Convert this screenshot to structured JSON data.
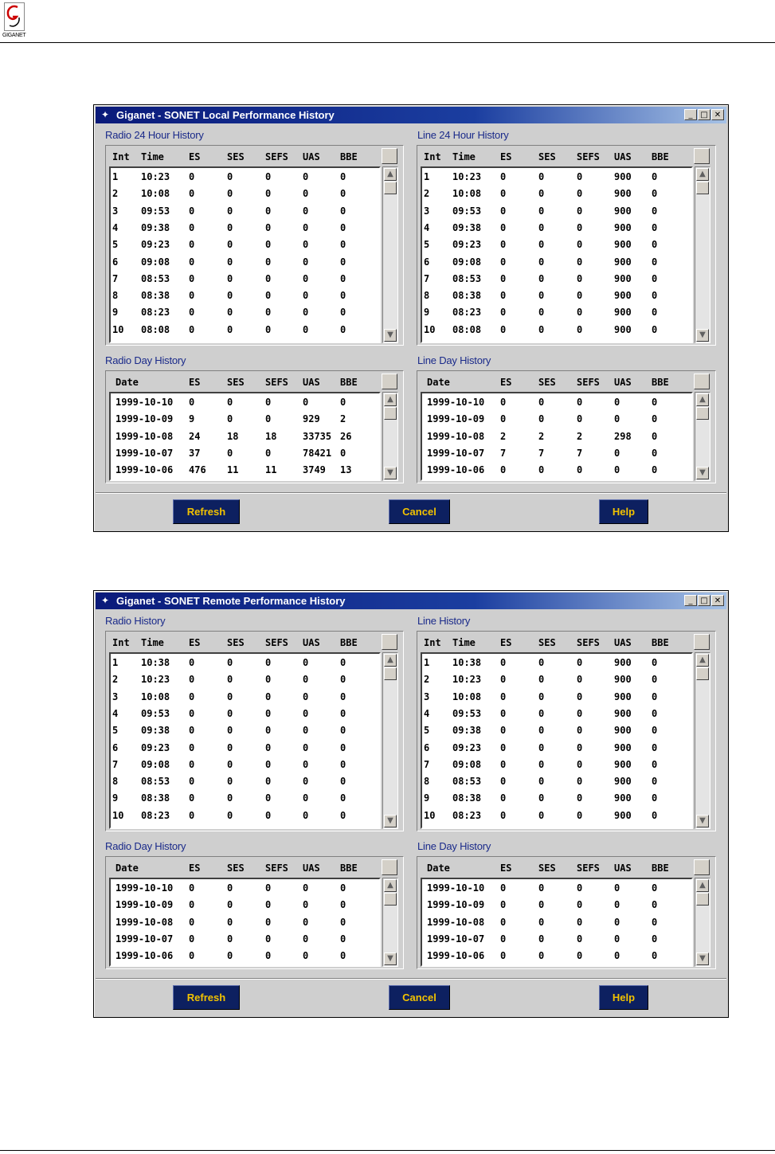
{
  "page": {
    "logo_text": "GIGANET"
  },
  "windows": [
    {
      "title": "Giganet - SONET Local Performance History",
      "panels": {
        "radio24": {
          "title": "Radio 24 Hour History",
          "headers": [
            "Int",
            "Time",
            "ES",
            "SES",
            "SEFS",
            "UAS",
            "BBE"
          ],
          "rows": [
            [
              "1",
              "10:23",
              "0",
              "0",
              "0",
              "0",
              "0"
            ],
            [
              "2",
              "10:08",
              "0",
              "0",
              "0",
              "0",
              "0"
            ],
            [
              "3",
              "09:53",
              "0",
              "0",
              "0",
              "0",
              "0"
            ],
            [
              "4",
              "09:38",
              "0",
              "0",
              "0",
              "0",
              "0"
            ],
            [
              "5",
              "09:23",
              "0",
              "0",
              "0",
              "0",
              "0"
            ],
            [
              "6",
              "09:08",
              "0",
              "0",
              "0",
              "0",
              "0"
            ],
            [
              "7",
              "08:53",
              "0",
              "0",
              "0",
              "0",
              "0"
            ],
            [
              "8",
              "08:38",
              "0",
              "0",
              "0",
              "0",
              "0"
            ],
            [
              "9",
              "08:23",
              "0",
              "0",
              "0",
              "0",
              "0"
            ],
            [
              "10",
              "08:08",
              "0",
              "0",
              "0",
              "0",
              "0"
            ]
          ]
        },
        "line24": {
          "title": "Line 24 Hour History",
          "headers": [
            "Int",
            "Time",
            "ES",
            "SES",
            "SEFS",
            "UAS",
            "BBE"
          ],
          "rows": [
            [
              "1",
              "10:23",
              "0",
              "0",
              "0",
              "900",
              "0"
            ],
            [
              "2",
              "10:08",
              "0",
              "0",
              "0",
              "900",
              "0"
            ],
            [
              "3",
              "09:53",
              "0",
              "0",
              "0",
              "900",
              "0"
            ],
            [
              "4",
              "09:38",
              "0",
              "0",
              "0",
              "900",
              "0"
            ],
            [
              "5",
              "09:23",
              "0",
              "0",
              "0",
              "900",
              "0"
            ],
            [
              "6",
              "09:08",
              "0",
              "0",
              "0",
              "900",
              "0"
            ],
            [
              "7",
              "08:53",
              "0",
              "0",
              "0",
              "900",
              "0"
            ],
            [
              "8",
              "08:38",
              "0",
              "0",
              "0",
              "900",
              "0"
            ],
            [
              "9",
              "08:23",
              "0",
              "0",
              "0",
              "900",
              "0"
            ],
            [
              "10",
              "08:08",
              "0",
              "0",
              "0",
              "900",
              "0"
            ]
          ]
        },
        "radioDay": {
          "title": "Radio Day History",
          "headers": [
            "Date",
            "ES",
            "SES",
            "SEFS",
            "UAS",
            "BBE"
          ],
          "rows": [
            [
              "1999-10-10",
              "0",
              "0",
              "0",
              "0",
              "0"
            ],
            [
              "1999-10-09",
              "9",
              "0",
              "0",
              "929",
              "2"
            ],
            [
              "1999-10-08",
              "24",
              "18",
              "18",
              "33735",
              "26"
            ],
            [
              "1999-10-07",
              "37",
              "0",
              "0",
              "78421",
              "0"
            ],
            [
              "1999-10-06",
              "476",
              "11",
              "11",
              "3749",
              "13"
            ]
          ]
        },
        "lineDay": {
          "title": "Line Day History",
          "headers": [
            "Date",
            "ES",
            "SES",
            "SEFS",
            "UAS",
            "BBE"
          ],
          "rows": [
            [
              "1999-10-10",
              "0",
              "0",
              "0",
              "0",
              "0"
            ],
            [
              "1999-10-09",
              "0",
              "0",
              "0",
              "0",
              "0"
            ],
            [
              "1999-10-08",
              "2",
              "2",
              "2",
              "298",
              "0"
            ],
            [
              "1999-10-07",
              "7",
              "7",
              "7",
              "0",
              "0"
            ],
            [
              "1999-10-06",
              "0",
              "0",
              "0",
              "0",
              "0"
            ]
          ]
        }
      },
      "buttons": {
        "refresh": "Refresh",
        "cancel": "Cancel",
        "help": "Help"
      }
    },
    {
      "title": "Giganet - SONET Remote Performance History",
      "panels": {
        "radio24": {
          "title": "Radio History",
          "headers": [
            "Int",
            "Time",
            "ES",
            "SES",
            "SEFS",
            "UAS",
            "BBE"
          ],
          "rows": [
            [
              "1",
              "10:38",
              "0",
              "0",
              "0",
              "0",
              "0"
            ],
            [
              "2",
              "10:23",
              "0",
              "0",
              "0",
              "0",
              "0"
            ],
            [
              "3",
              "10:08",
              "0",
              "0",
              "0",
              "0",
              "0"
            ],
            [
              "4",
              "09:53",
              "0",
              "0",
              "0",
              "0",
              "0"
            ],
            [
              "5",
              "09:38",
              "0",
              "0",
              "0",
              "0",
              "0"
            ],
            [
              "6",
              "09:23",
              "0",
              "0",
              "0",
              "0",
              "0"
            ],
            [
              "7",
              "09:08",
              "0",
              "0",
              "0",
              "0",
              "0"
            ],
            [
              "8",
              "08:53",
              "0",
              "0",
              "0",
              "0",
              "0"
            ],
            [
              "9",
              "08:38",
              "0",
              "0",
              "0",
              "0",
              "0"
            ],
            [
              "10",
              "08:23",
              "0",
              "0",
              "0",
              "0",
              "0"
            ]
          ]
        },
        "line24": {
          "title": "Line History",
          "headers": [
            "Int",
            "Time",
            "ES",
            "SES",
            "SEFS",
            "UAS",
            "BBE"
          ],
          "rows": [
            [
              "1",
              "10:38",
              "0",
              "0",
              "0",
              "900",
              "0"
            ],
            [
              "2",
              "10:23",
              "0",
              "0",
              "0",
              "900",
              "0"
            ],
            [
              "3",
              "10:08",
              "0",
              "0",
              "0",
              "900",
              "0"
            ],
            [
              "4",
              "09:53",
              "0",
              "0",
              "0",
              "900",
              "0"
            ],
            [
              "5",
              "09:38",
              "0",
              "0",
              "0",
              "900",
              "0"
            ],
            [
              "6",
              "09:23",
              "0",
              "0",
              "0",
              "900",
              "0"
            ],
            [
              "7",
              "09:08",
              "0",
              "0",
              "0",
              "900",
              "0"
            ],
            [
              "8",
              "08:53",
              "0",
              "0",
              "0",
              "900",
              "0"
            ],
            [
              "9",
              "08:38",
              "0",
              "0",
              "0",
              "900",
              "0"
            ],
            [
              "10",
              "08:23",
              "0",
              "0",
              "0",
              "900",
              "0"
            ]
          ]
        },
        "radioDay": {
          "title": "Radio Day History",
          "headers": [
            "Date",
            "ES",
            "SES",
            "SEFS",
            "UAS",
            "BBE"
          ],
          "rows": [
            [
              "1999-10-10",
              "0",
              "0",
              "0",
              "0",
              "0"
            ],
            [
              "1999-10-09",
              "0",
              "0",
              "0",
              "0",
              "0"
            ],
            [
              "1999-10-08",
              "0",
              "0",
              "0",
              "0",
              "0"
            ],
            [
              "1999-10-07",
              "0",
              "0",
              "0",
              "0",
              "0"
            ],
            [
              "1999-10-06",
              "0",
              "0",
              "0",
              "0",
              "0"
            ]
          ]
        },
        "lineDay": {
          "title": "Line Day History",
          "headers": [
            "Date",
            "ES",
            "SES",
            "SEFS",
            "UAS",
            "BBE"
          ],
          "rows": [
            [
              "1999-10-10",
              "0",
              "0",
              "0",
              "0",
              "0"
            ],
            [
              "1999-10-09",
              "0",
              "0",
              "0",
              "0",
              "0"
            ],
            [
              "1999-10-08",
              "0",
              "0",
              "0",
              "0",
              "0"
            ],
            [
              "1999-10-07",
              "0",
              "0",
              "0",
              "0",
              "0"
            ],
            [
              "1999-10-06",
              "0",
              "0",
              "0",
              "0",
              "0"
            ]
          ]
        }
      },
      "buttons": {
        "refresh": "Refresh",
        "cancel": "Cancel",
        "help": "Help"
      }
    }
  ],
  "icons": {
    "logo": "giganet-logo-icon",
    "window_icon": "giganet-app-icon",
    "minimize": "minimize-icon",
    "maximize": "maximize-icon",
    "close": "close-icon",
    "scroll_up": "scroll-up-arrow-icon",
    "scroll_down": "scroll-down-arrow-icon"
  },
  "colors": {
    "title_bar_start": "#0a1a7a",
    "title_bar_end": "#a6c2e6",
    "button_bg": "#0d2060",
    "button_text": "#f2c200",
    "panel_title": "#1a2a8a"
  }
}
